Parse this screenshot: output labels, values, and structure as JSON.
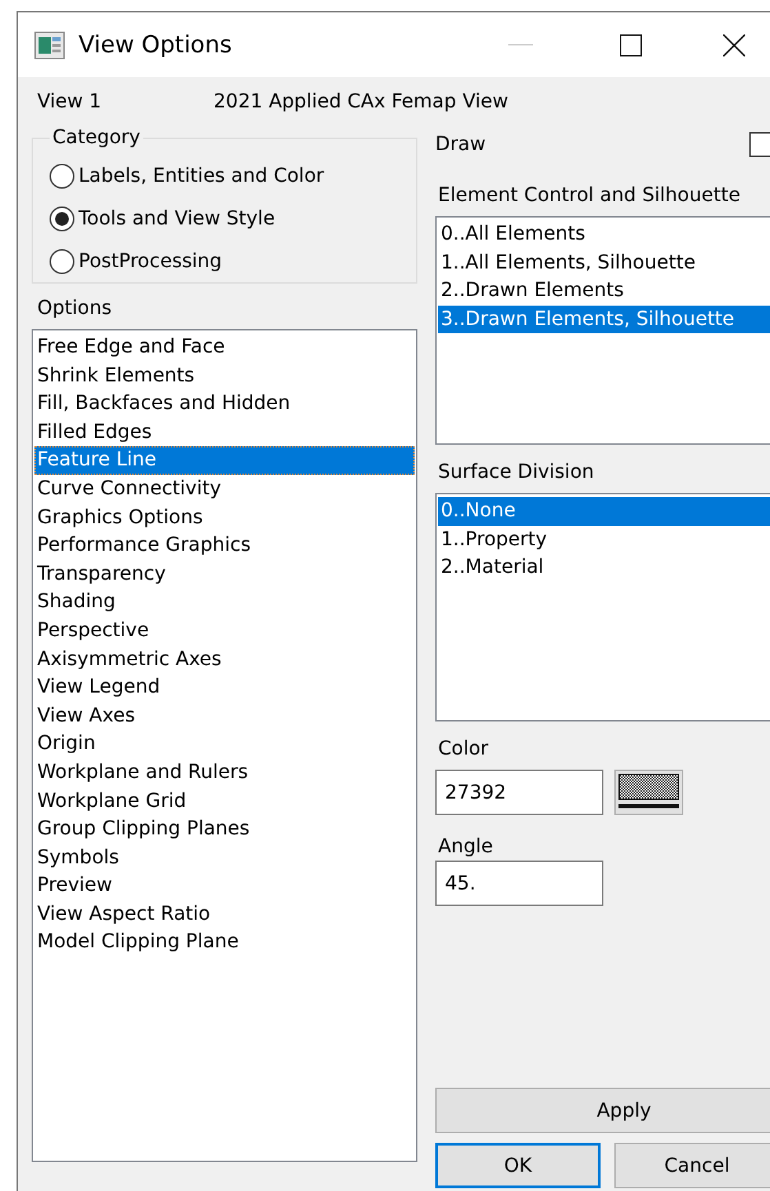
{
  "window": {
    "title": "View Options"
  },
  "view": {
    "name": "View 1",
    "title": "2021 Applied CAx Femap View"
  },
  "category": {
    "label": "Category",
    "options": [
      {
        "label": "Labels, Entities and Color",
        "selected": false
      },
      {
        "label": "Tools and View Style",
        "selected": true
      },
      {
        "label": "PostProcessing",
        "selected": false
      }
    ]
  },
  "options": {
    "label": "Options",
    "items": [
      {
        "label": "Free Edge and Face",
        "selected": false
      },
      {
        "label": "Shrink Elements",
        "selected": false
      },
      {
        "label": "Fill, Backfaces and Hidden",
        "selected": false
      },
      {
        "label": "Filled Edges",
        "selected": false
      },
      {
        "label": "Feature Line",
        "selected": true
      },
      {
        "label": "Curve Connectivity",
        "selected": false
      },
      {
        "label": "Graphics Options",
        "selected": false
      },
      {
        "label": "Performance Graphics",
        "selected": false
      },
      {
        "label": "Transparency",
        "selected": false
      },
      {
        "label": "Shading",
        "selected": false
      },
      {
        "label": "Perspective",
        "selected": false
      },
      {
        "label": "Axisymmetric Axes",
        "selected": false
      },
      {
        "label": "View Legend",
        "selected": false
      },
      {
        "label": "View Axes",
        "selected": false
      },
      {
        "label": "Origin",
        "selected": false
      },
      {
        "label": "Workplane and Rulers",
        "selected": false
      },
      {
        "label": "Workplane Grid",
        "selected": false
      },
      {
        "label": "Group Clipping Planes",
        "selected": false
      },
      {
        "label": "Symbols",
        "selected": false
      },
      {
        "label": "Preview",
        "selected": false
      },
      {
        "label": "View Aspect Ratio",
        "selected": false
      },
      {
        "label": "Model Clipping Plane",
        "selected": false
      }
    ]
  },
  "draw": {
    "label": "Draw",
    "checked": false
  },
  "element_control": {
    "label": "Element Control and Silhouette",
    "items": [
      {
        "label": "0..All Elements",
        "selected": false
      },
      {
        "label": "1..All Elements, Silhouette",
        "selected": false
      },
      {
        "label": "2..Drawn Elements",
        "selected": false
      },
      {
        "label": "3..Drawn Elements, Silhouette",
        "selected": true
      }
    ]
  },
  "surface_division": {
    "label": "Surface Division",
    "items": [
      {
        "label": "0..None",
        "selected": true
      },
      {
        "label": "1..Property",
        "selected": false
      },
      {
        "label": "2..Material",
        "selected": false
      }
    ]
  },
  "color": {
    "label": "Color",
    "value": "27392"
  },
  "angle": {
    "label": "Angle",
    "value": "45."
  },
  "buttons": [
    {
      "label": "Apply",
      "kind": "wide"
    },
    {
      "label": "OK",
      "kind": "default"
    },
    {
      "label": "Cancel",
      "kind": "normal"
    }
  ]
}
